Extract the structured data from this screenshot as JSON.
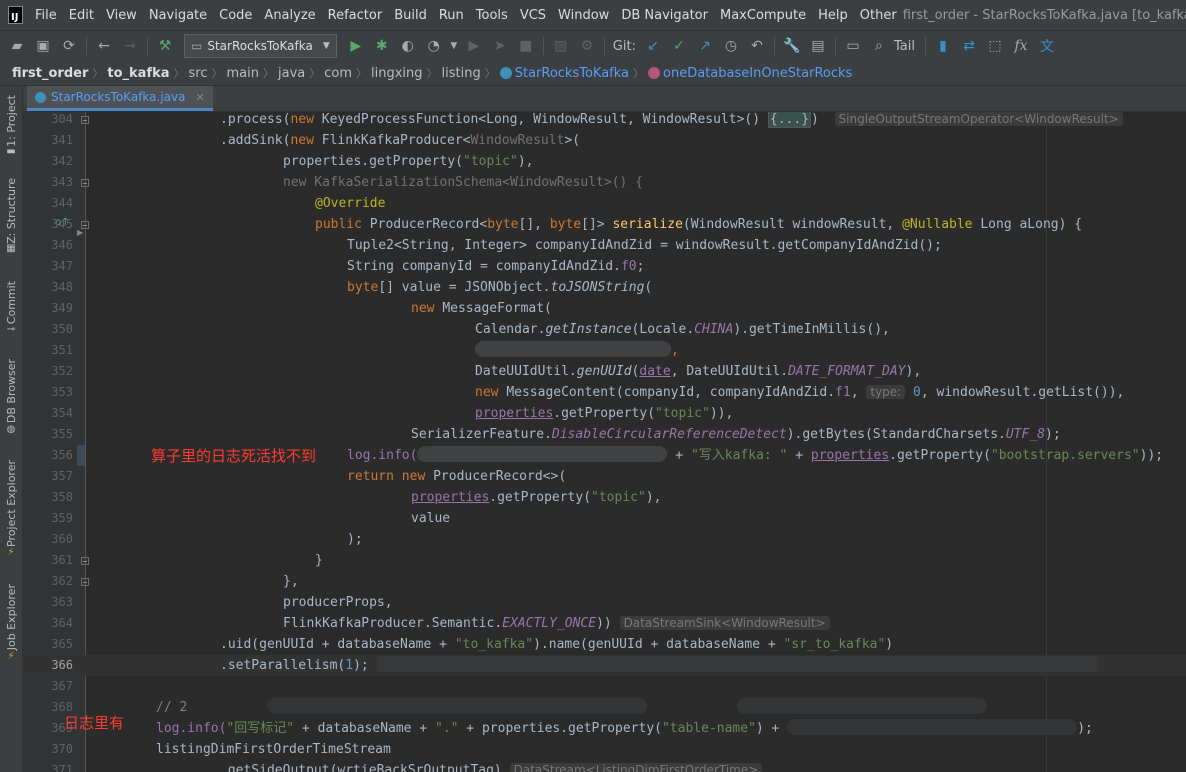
{
  "menubar": {
    "items": [
      "File",
      "Edit",
      "View",
      "Navigate",
      "Code",
      "Analyze",
      "Refactor",
      "Build",
      "Run",
      "Tools",
      "VCS",
      "Window",
      "DB Navigator",
      "MaxCompute",
      "Help",
      "Other"
    ],
    "window_title": "first_order - StarRocksToKafka.java [to_kafka] - IntelliJ I"
  },
  "toolbar": {
    "run_config": "StarRocksToKafka",
    "git_label": "Git:",
    "tail_label": "Tail"
  },
  "breadcrumbs": [
    "first_order",
    "to_kafka",
    "src",
    "main",
    "java",
    "com",
    "lingxing",
    "listing",
    "StarRocksToKafka",
    "oneDatabaseInOneStarRocks"
  ],
  "sidebar": {
    "tabs": [
      "1: Project",
      "Z: Structure",
      "Commit",
      "DB Browser",
      "Project Explorer",
      "Job Explorer"
    ]
  },
  "editor": {
    "tab_name": "StarRocksToKafka.java",
    "line_numbers": [
      "304",
      "341",
      "342",
      "343",
      "344",
      "345",
      "346",
      "347",
      "348",
      "349",
      "350",
      "351",
      "352",
      "353",
      "354",
      "355",
      "356",
      "357",
      "358",
      "359",
      "360",
      "361",
      "362",
      "363",
      "364",
      "365",
      "366",
      "367",
      "368",
      "369",
      "370",
      "371"
    ],
    "current_line": "366",
    "annotations": {
      "note_1": "算子里的日志死活找不到",
      "note_2": "日志里有"
    },
    "hints": {
      "l304": "SingleOutputStreamOperator<WindowResult>",
      "l354": "type:",
      "l364": "DataStreamSink<WindowResult>",
      "l371": "DataStream<ListingDimFirstOrderTime>"
    },
    "tokens": {
      "l304_method": ".process(",
      "l304_new": "new ",
      "l304_type": "KeyedProcessFunction<Long, WindowResult, WindowResult>() ",
      "l304_fold": "{...}",
      "l304_close": ")",
      "l341_method": ".addSink(",
      "l341_new": "new ",
      "l341_type": "FlinkKafkaProducer<",
      "l341_generic": "WindowResult",
      "l341_close": ">(",
      "l342_a": "properties.getProperty(",
      "l342_str": "\"topic\"",
      "l342_b": "),",
      "l343_a": "new KafkaSerializationSchema<WindowResult>() {",
      "l344_ann": "@Override",
      "l345_kw": "public ",
      "l345_a": "ProducerRecord<",
      "l345_kw2": "byte",
      "l345_b": "[], ",
      "l345_kw3": "byte",
      "l345_c": "[]> ",
      "l345_fn": "serialize",
      "l345_d": "(WindowResult windowResult, ",
      "l345_ann": "@Nullable",
      "l345_e": " Long aLong) {",
      "l346": "Tuple2<String, Integer> companyIdAndZid = windowResult.getCompanyIdAndZid();",
      "l347_a": "String companyId = companyIdAndZid.",
      "l347_fld": "f0",
      "l347_b": ";",
      "l348_kw": "byte",
      "l348_a": "[] value = JSONObject.",
      "l348_it": "toJSONString",
      "l348_b": "(",
      "l349_kw": "new ",
      "l349_a": "MessageFormat(",
      "l350_a": "Calendar.",
      "l350_it": "getInstance",
      "l350_b": "(Locale.",
      "l350_fld": "CHINA",
      "l350_c": ").getTimeInMillis(),",
      "l351_a": ",",
      "l352_a": "DateUUIdUtil.",
      "l352_it": "genUUId",
      "l352_b": "(",
      "l352_ul": "date",
      "l352_c": ", DateUUIdUtil.",
      "l352_fld": "DATE_FORMAT_DAY",
      "l352_d": "),",
      "l353_kw": "new ",
      "l353_a": "MessageContent(companyId, companyIdAndZid.",
      "l353_fld": "f1",
      "l353_b": ", ",
      "l353_num": "0",
      "l353_c": ", windowResult.getList()),",
      "l354_ul": "properties",
      "l354_a": ".getProperty(",
      "l354_str": "\"topic\"",
      "l354_b": ")),",
      "l355_a": "SerializerFeature.",
      "l355_fld": "DisableCircularReferenceDetect",
      "l355_b": ").getBytes(StandardCharsets.",
      "l355_fld2": "UTF_8",
      "l355_c": ");",
      "l356_a": "log.info(",
      "l356_b": " + ",
      "l356_str": "\"写入kafka: \"",
      "l356_c": " + ",
      "l356_ul": "properties",
      "l356_d": ".getProperty(",
      "l356_str2": "\"bootstrap.servers\"",
      "l356_e": "));",
      "l357_kw": "return new ",
      "l357_a": "ProducerRecord<>(",
      "l358_ul": "properties",
      "l358_a": ".getProperty(",
      "l358_str": "\"topic\"",
      "l358_b": "),",
      "l359": "value",
      "l360": ");",
      "l361": "}",
      "l362": "},",
      "l363": "producerProps,",
      "l364_a": "FlinkKafkaProducer.Semantic.",
      "l364_fld": "EXACTLY_ONCE",
      "l364_b": "))",
      "l365_a": ".uid(genUUId + databaseName + ",
      "l365_str": "\"to_kafka\"",
      "l365_b": ").name(genUUId + databaseName + ",
      "l365_str2": "\"sr_to_kafka\"",
      "l365_c": ")",
      "l366_a": ".setParallelism(",
      "l366_num": "1",
      "l366_b": ");",
      "l368_cm": "// 2",
      "l369_a": "log.info(",
      "l369_str": "\"回写标记\"",
      "l369_b": " + databaseName + ",
      "l369_str2": "\".\"",
      "l369_c": " + properties.getProperty(",
      "l369_str3": "\"table-name\"",
      "l369_d": ") +",
      "l369_e": ");",
      "l370": "listingDimFirstOrderTimeStream",
      "l371": ".getSideOutput(wrtieBackSrOutputTag)"
    }
  }
}
